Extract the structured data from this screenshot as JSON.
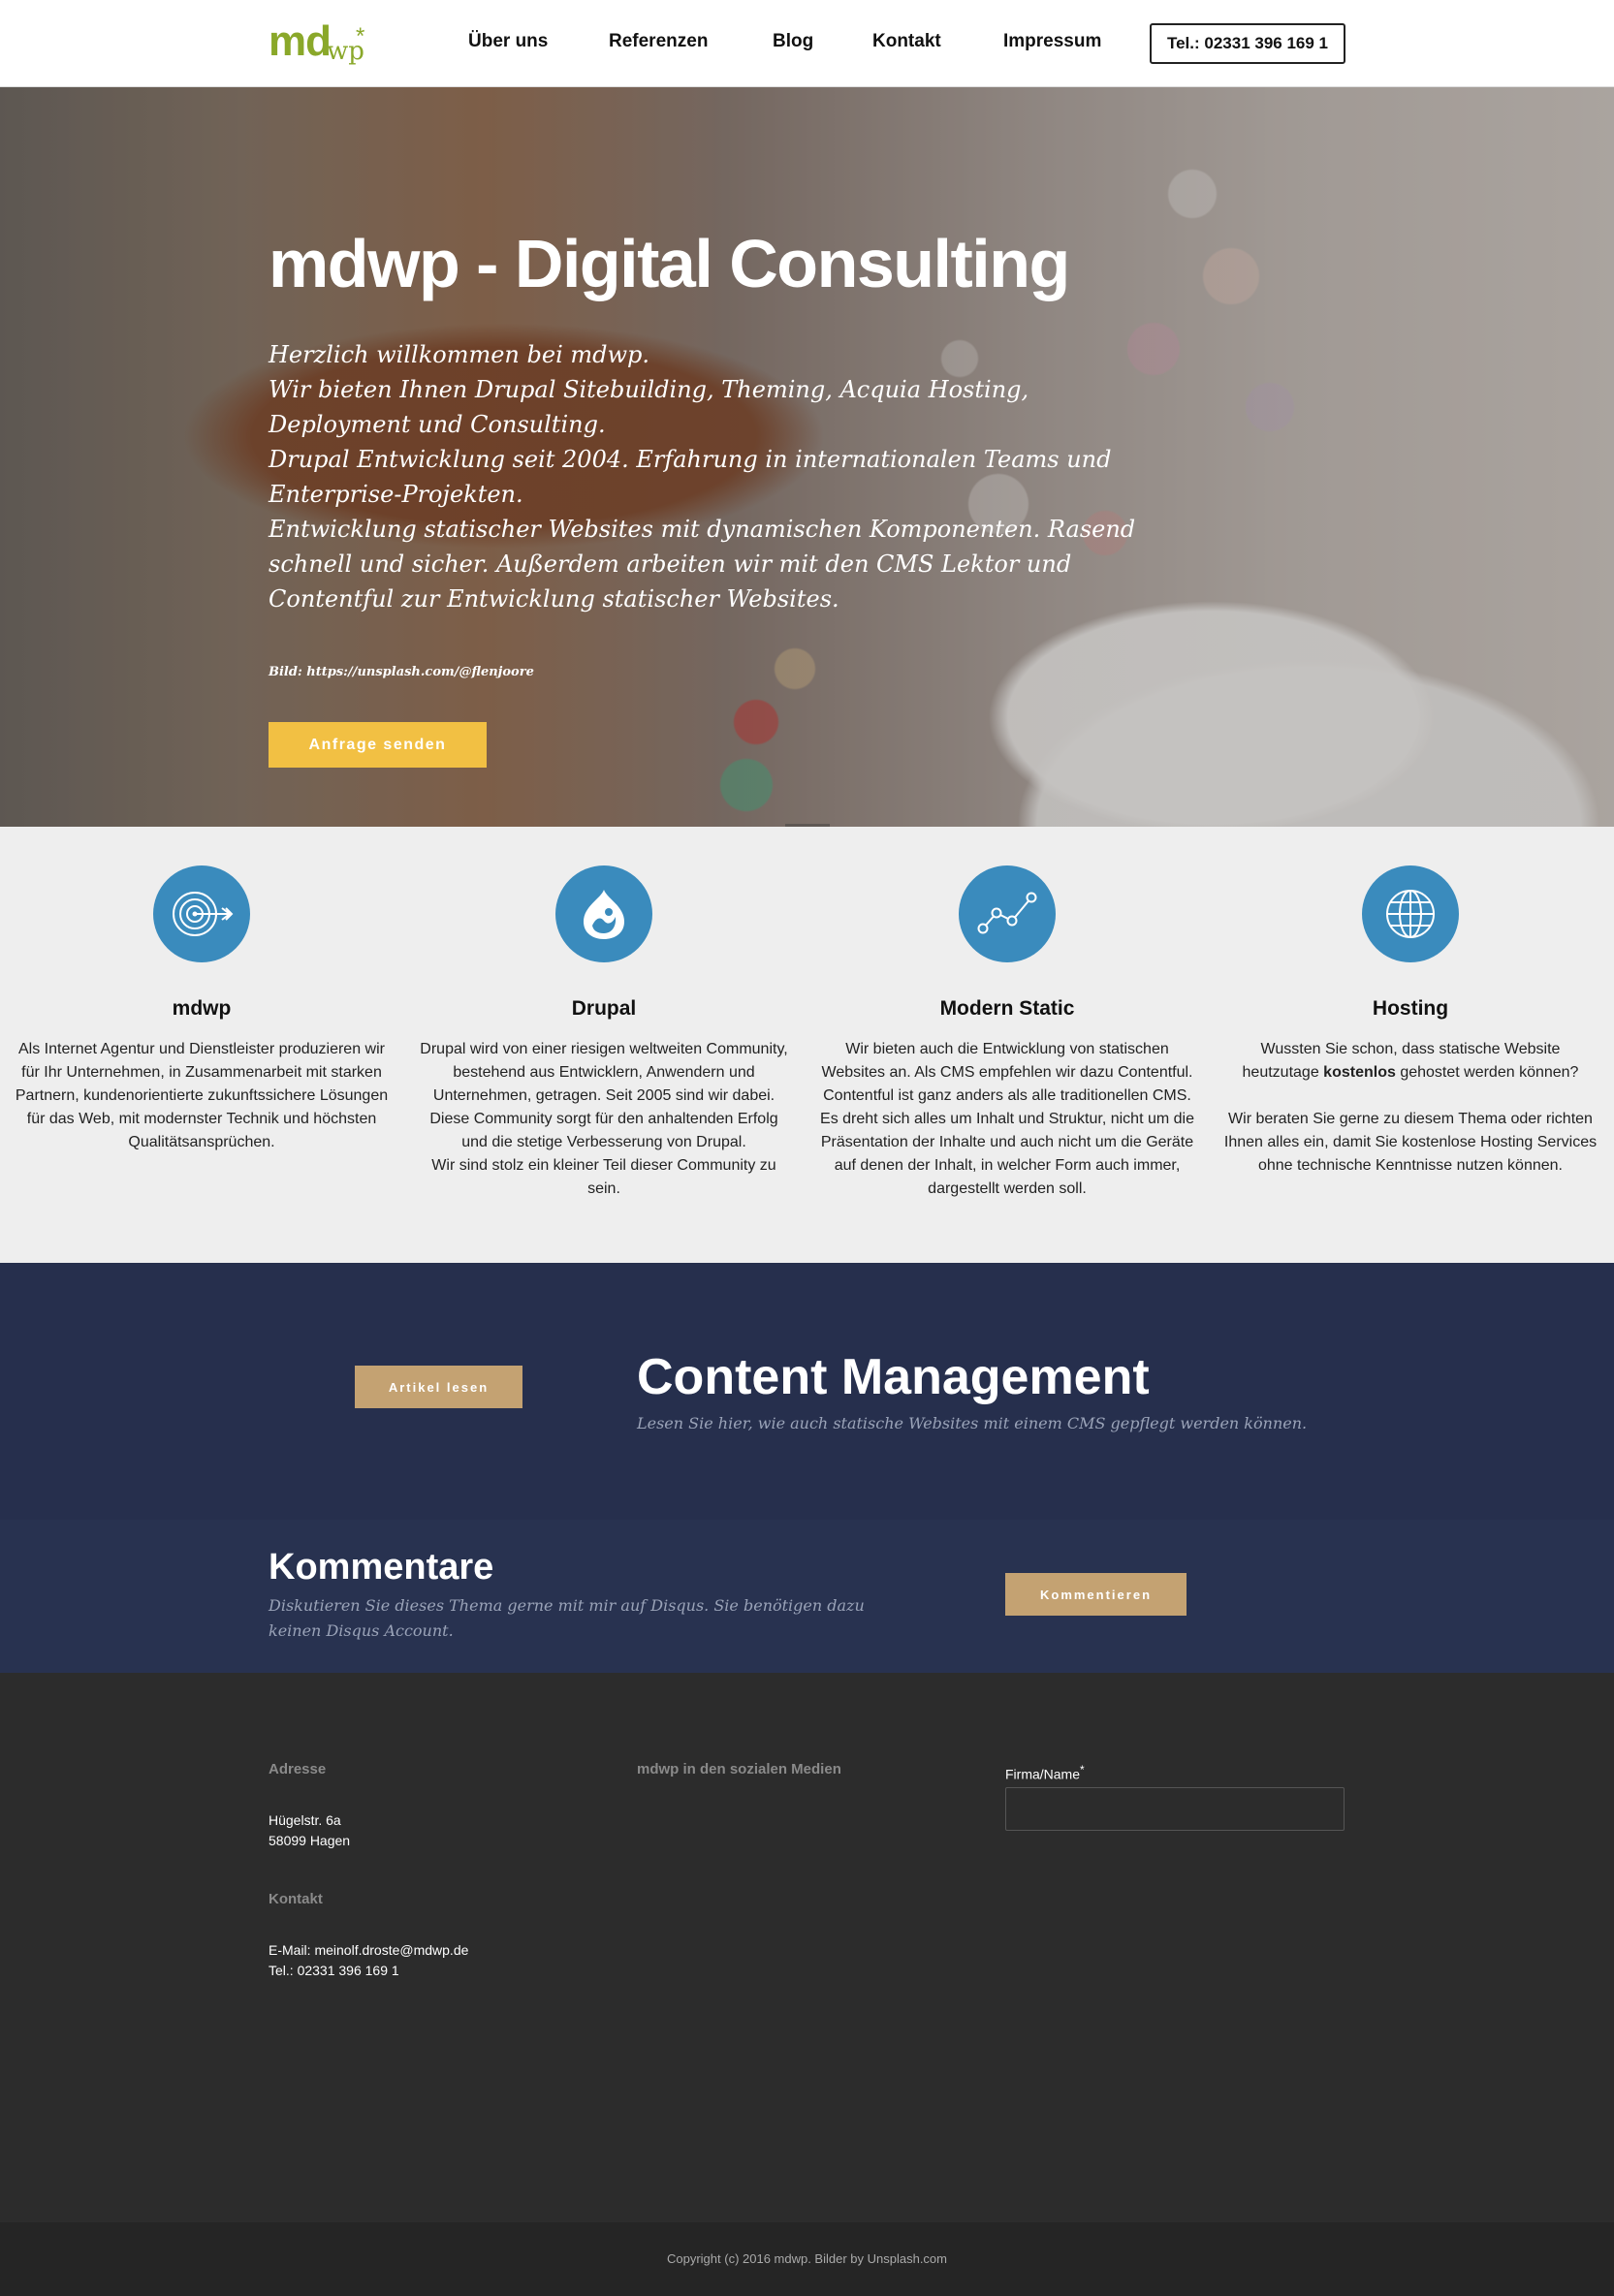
{
  "nav": {
    "logo_md": "md",
    "logo_wp": "wp",
    "logo_star": "*",
    "items": [
      "Über uns",
      "Referenzen",
      "Blog",
      "Kontakt",
      "Impressum"
    ],
    "phone": "Tel.: 02331 396 169 1"
  },
  "hero": {
    "title": "mdwp - Digital Consulting",
    "lines": [
      "Herzlich willkommen bei mdwp.",
      "Wir bieten Ihnen Drupal Sitebuilding, Theming, Acquia Hosting, Deployment und Consulting.",
      "Drupal Entwicklung seit 2004. Erfahrung in internationalen Teams und Enterprise-Projekten.",
      "Entwicklung statischer Websites mit dynamischen Komponenten. Rasend schnell und sicher. Außerdem arbeiten wir mit den CMS Lektor und Contentful zur Entwicklung statischer Websites."
    ],
    "credit": "Bild: https://unsplash.com/@flenjoore",
    "button": "Anfrage senden",
    "scroll_icon": "chevron-down-icon"
  },
  "features": [
    {
      "icon": "target-icon",
      "title": "mdwp",
      "text": "Als Internet Agentur und Dienstleister produzieren wir für Ihr Unternehmen, in Zusammenarbeit mit starken Partnern, kundenorientierte zukunftssichere Lösungen für das Web, mit modernster Technik und höchsten Qualitätsansprüchen."
    },
    {
      "icon": "drupal-icon",
      "title": "Drupal",
      "text": "Drupal wird von einer riesigen weltweiten Community, bestehend aus Entwicklern, Anwendern und Unternehmen, getragen. Seit 2005 sind wir dabei.",
      "text2": "Diese Community sorgt für den anhaltenden Erfolg und die stetige Verbesserung von Drupal.",
      "text3": "Wir sind stolz ein kleiner Teil dieser Community zu sein."
    },
    {
      "icon": "chart-line-icon",
      "title": "Modern Static",
      "text": "Wir bieten auch die Entwicklung von statischen Websites an. Als CMS empfehlen wir dazu Contentful.",
      "text2": "Contentful ist ganz anders als alle traditionellen CMS. Es dreht sich alles um Inhalt und Struktur, nicht um die Präsentation der Inhalte und auch nicht um die Geräte auf denen der Inhalt, in welcher Form auch immer, dargestellt werden soll."
    },
    {
      "icon": "globe-icon",
      "title": "Hosting",
      "text_before": "Wussten Sie schon, dass statische Website heutzutage",
      "text_bold": "kostenlos",
      "text_after": "gehostet werden können?",
      "text2": "Wir beraten Sie gerne zu diesem Thema oder richten Ihnen alles ein, damit Sie kostenlose Hosting Services ohne technische Kenntnisse nutzen können."
    }
  ],
  "cm": {
    "button": "Artikel lesen",
    "title": "Content Management",
    "subtitle": "Lesen Sie hier, wie auch statische Websites mit einem CMS gepflegt werden können."
  },
  "comments": {
    "title": "Kommentare",
    "subtitle": "Diskutieren Sie dieses Thema gerne mit mir auf Disqus. Sie benötigen dazu keinen Disqus Account.",
    "button": "Kommentieren"
  },
  "footer": {
    "address_head": "Adresse",
    "address_line1": "Hügelstr. 6a",
    "address_line2": "58099 Hagen",
    "contact_head": "Kontakt",
    "contact_email": "E-Mail: meinolf.droste@mdwp.de",
    "contact_tel": "Tel.: 02331 396 169 1",
    "social_head": "mdwp in den sozialen Medien",
    "form_label": "Firma/Name",
    "form_required": "*",
    "form_value": ""
  },
  "copyright": "Copyright (c) 2016 mdwp.  Bilder by Unsplash.com",
  "colors": {
    "brand_green": "#8aa82a",
    "accent_yellow": "#f2c043",
    "icon_blue": "#3a8bbd",
    "navy": "#262f4d",
    "gold": "#c4a272",
    "footer_dark": "#2c2c2c"
  }
}
